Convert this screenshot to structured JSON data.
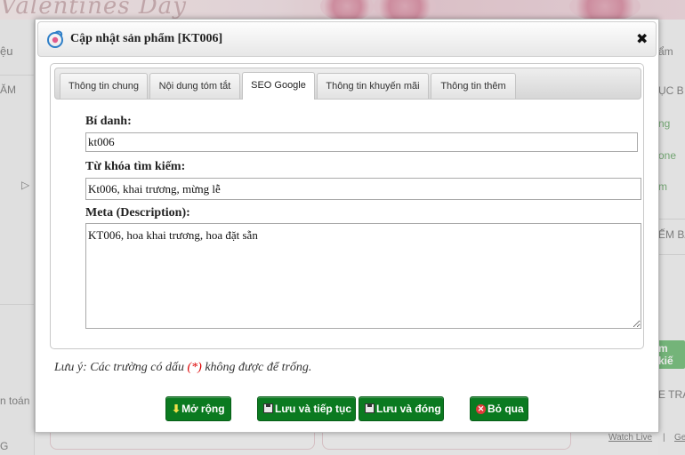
{
  "background": {
    "banner_text": "Valentines Day",
    "left_fragments": [
      "ệu",
      "ĂM",
      "▷",
      "n toán",
      "G"
    ],
    "right_fragments": [
      "ẩm",
      "ỤC B",
      "ng",
      "one",
      "m",
      "ẾM BA",
      "m kiế",
      "E TRA"
    ],
    "footer_links": [
      "Watch Live",
      "Ge"
    ]
  },
  "dialog": {
    "title": "Cập nhật sản phẩm [KT006]",
    "close_symbol": "✖",
    "tabs": [
      {
        "label": "Thông tin chung",
        "active": false
      },
      {
        "label": "Nội dung tóm tắt",
        "active": false
      },
      {
        "label": "SEO Google",
        "active": true
      },
      {
        "label": "Thông tin khuyến mãi",
        "active": false
      },
      {
        "label": "Thông tin thêm",
        "active": false
      }
    ],
    "fields": {
      "alias_label": "Bí danh:",
      "alias_value": "kt006",
      "keywords_label": "Từ khóa tìm kiếm:",
      "keywords_value": "Kt006, khai trương, mừng lễ",
      "meta_label": "Meta (Description):",
      "meta_value": "KT006, hoa khai trương, hoa đặt sẵn"
    },
    "note": {
      "prefix": "Lưu ý: Các trường có dấu ",
      "required_mark": "(*)",
      "suffix": " không được để trống."
    },
    "buttons": {
      "expand": "Mở rộng",
      "save_continue": "Lưu và tiếp tục",
      "save_close": "Lưu và đóng",
      "skip": "Bỏ qua"
    }
  },
  "colors": {
    "button_green": "#0b7a20",
    "required_red": "#dd0000"
  }
}
